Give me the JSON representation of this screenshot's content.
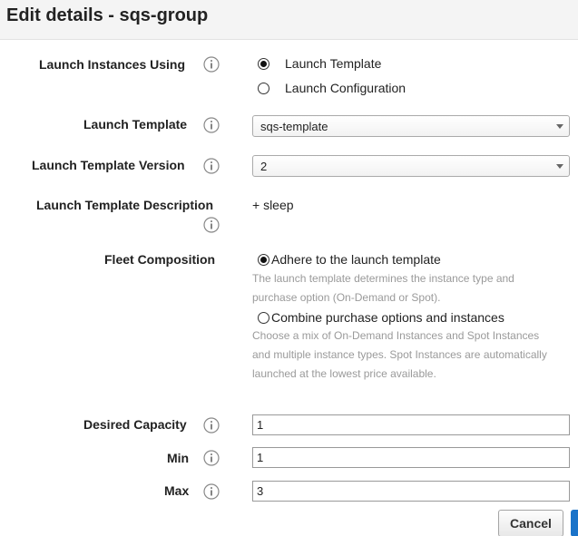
{
  "header": {
    "title": "Edit details - sqs-group"
  },
  "launch_using": {
    "label": "Launch Instances Using",
    "options": [
      {
        "label": "Launch Template",
        "checked": true
      },
      {
        "label": "Launch Configuration",
        "checked": false
      }
    ]
  },
  "launch_template": {
    "label": "Launch Template",
    "value": "sqs-template"
  },
  "template_version": {
    "label": "Launch Template Version",
    "value": "2"
  },
  "template_description": {
    "label": "Launch Template Description",
    "value": "+ sleep"
  },
  "fleet": {
    "label": "Fleet Composition",
    "options": [
      {
        "label": "Adhere to the launch template",
        "checked": true,
        "help_lines": [
          "The launch template determines the instance type and",
          "purchase option (On-Demand or Spot)."
        ]
      },
      {
        "label": "Combine purchase options and instances",
        "checked": false,
        "help_lines": [
          "Choose a mix of On-Demand Instances and Spot Instances",
          "and multiple instance types. Spot Instances are automatically",
          "launched at the lowest price available."
        ]
      }
    ]
  },
  "desired_capacity": {
    "label": "Desired Capacity",
    "value": "1"
  },
  "min": {
    "label": "Min",
    "value": "1"
  },
  "max": {
    "label": "Max",
    "value": "3"
  },
  "buttons": {
    "cancel": "Cancel"
  },
  "icons": {
    "info": "info-icon",
    "dropdown": "chevron-down-icon"
  }
}
